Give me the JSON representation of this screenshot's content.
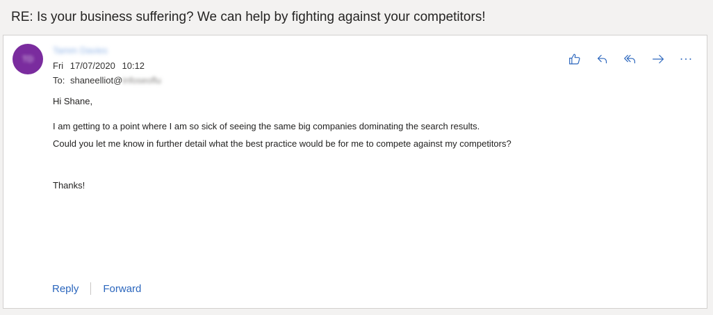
{
  "subject": "RE: Is your business suffering? We can help by fighting against your competitors!",
  "message": {
    "avatar_initials": "TD",
    "avatar_color": "#7a2c9e",
    "sender_name": "Tamm Davies",
    "date_day": "Fri",
    "date": "17/07/2020",
    "time": "10:12",
    "to_label": "To:",
    "to_address": "shaneelliot@",
    "to_domain": "infoseoflu"
  },
  "actions": [
    {
      "icon": "like-icon"
    },
    {
      "icon": "reply-icon"
    },
    {
      "icon": "reply-all-icon"
    },
    {
      "icon": "forward-icon"
    },
    {
      "icon": "more-icon"
    }
  ],
  "body": {
    "greeting": "Hi Shane,",
    "line1": "I am getting to a point where I am so sick of seeing the same big companies dominating the search results.",
    "line2": "Could you let me know in further detail what the best practice would be for me to compete against my competitors?",
    "closing": "Thanks!"
  },
  "footer": {
    "reply_label": "Reply",
    "forward_label": "Forward"
  },
  "colors": {
    "accent": "#2b66bd",
    "icon": "#2b66bd",
    "background": "#f3f2f1"
  }
}
